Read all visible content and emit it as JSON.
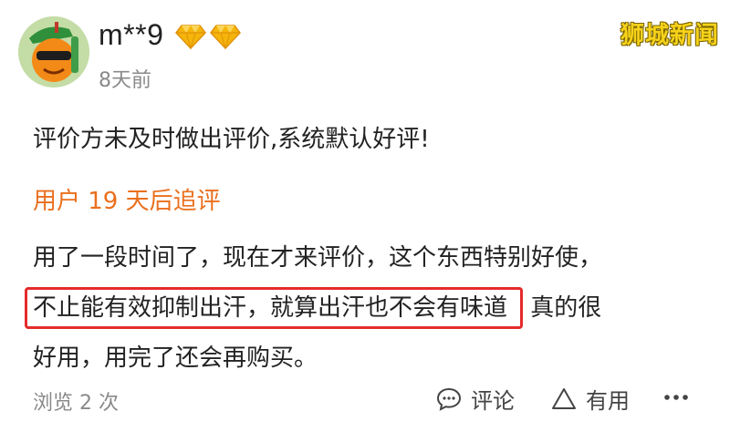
{
  "user": {
    "name": "m**9",
    "time": "8天前",
    "badges": [
      "diamond-icon",
      "diamond-icon"
    ],
    "avatar_icon": "orange-cartoon-avatar"
  },
  "watermark": "狮城新闻",
  "review": {
    "text": "评价方未及时做出评价,系统默认好评!"
  },
  "followup": {
    "title": "用户 19 天后追评",
    "line1": "用了一段时间了，现在才来评价，这个东西特别好使，",
    "line2_highlight": "不止能有效抑制出汗，就算出汗也不会有味道",
    "line2_rest": "真的很",
    "line3": "好用，用完了还会再购买。"
  },
  "footer": {
    "views": "浏览 2 次",
    "comment_label": "评论",
    "useful_label": "有用",
    "more_icon": "more-dots-icon"
  },
  "colors": {
    "accent_orange": "#ea6f1d",
    "highlight_red": "#e52b2b",
    "diamond_gold": "#f5b50a",
    "watermark": "#f6d21a"
  }
}
